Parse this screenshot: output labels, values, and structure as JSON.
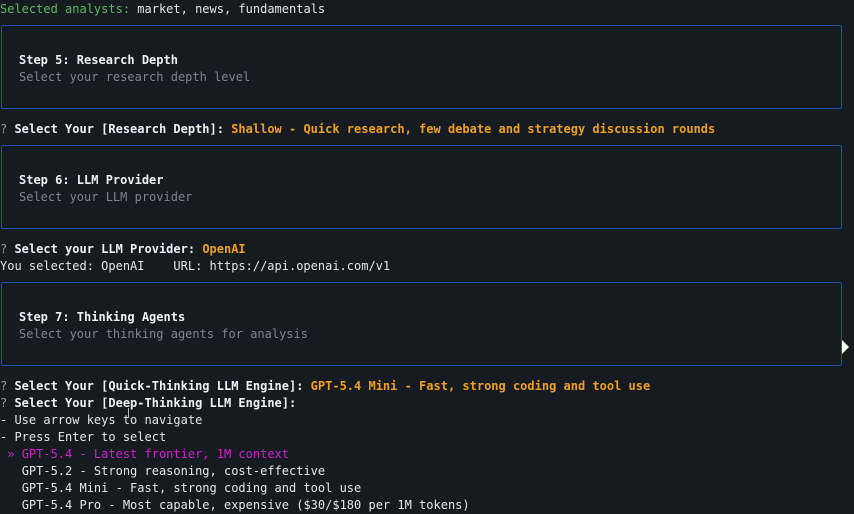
{
  "selected_line": {
    "label": "Selected analysts:",
    "value": " market, news, fundamentals"
  },
  "step5": {
    "title": "Step 5: Research Depth",
    "subtitle": "Select your research depth level"
  },
  "q_depth": {
    "mark": "?",
    "label": " Select Your [Research Depth]: ",
    "answer": "Shallow - Quick research, few debate and strategy discussion rounds"
  },
  "step6": {
    "title": "Step 6: LLM Provider",
    "subtitle": "Select your LLM provider"
  },
  "q_provider": {
    "mark": "?",
    "label": " Select your LLM Provider: ",
    "answer": "OpenAI"
  },
  "provider_info": "You selected: OpenAI    URL: https://api.openai.com/v1",
  "step7": {
    "title": "Step 7: Thinking Agents",
    "subtitle": "Select your thinking agents for analysis"
  },
  "q_quick": {
    "mark": "?",
    "label": " Select Your [Quick-Thinking LLM Engine]: ",
    "answer": "GPT-5.4 Mini - Fast, strong coding and tool use"
  },
  "q_deep": {
    "mark": "?",
    "label": " Select Your [Deep-Thinking LLM Engine]:"
  },
  "hints": [
    "- Use arrow keys to navigate",
    "- Press Enter to select"
  ],
  "options": [
    {
      "prefix": " » ",
      "label": "GPT-5.4 - Latest frontier, 1M context",
      "selected": true
    },
    {
      "prefix": "   ",
      "label": "GPT-5.2 - Strong reasoning, cost-effective",
      "selected": false
    },
    {
      "prefix": "   ",
      "label": "GPT-5.4 Mini - Fast, strong coding and tool use",
      "selected": false
    },
    {
      "prefix": "   ",
      "label": "GPT-5.4 Pro - Most capable, expensive ($30/$180 per 1M tokens)",
      "selected": false
    }
  ],
  "colors": {
    "background": "#161b22",
    "panel_border": "#1f4fa8",
    "answer": "#f0a020",
    "selected_option": "#d020d0",
    "selected_label": "#5fb85f"
  }
}
